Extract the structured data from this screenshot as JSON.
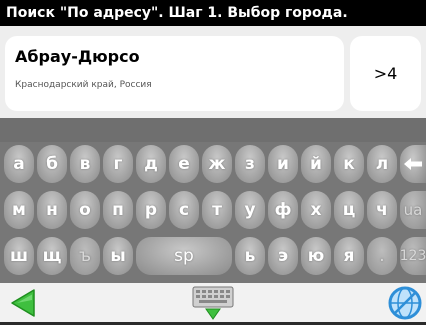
{
  "header": {
    "title": "Поиск \"По адресу\". Шаг 1. Выбор города."
  },
  "result": {
    "name": "Абрау-Дюрсо",
    "region": "Краснодарский край, Россия",
    "count": ">4"
  },
  "keyboard": {
    "row1": [
      "а",
      "б",
      "в",
      "г",
      "д",
      "е",
      "ж",
      "з",
      "и",
      "й",
      "к",
      "л"
    ],
    "row2": [
      "м",
      "н",
      "о",
      "п",
      "р",
      "с",
      "т",
      "у",
      "ф",
      "х",
      "ц",
      "ч",
      "ua"
    ],
    "row3_left": [
      "ш",
      "щ",
      "ъ",
      "ы"
    ],
    "space": "sp",
    "row3_right": [
      "ь",
      "э",
      "ю",
      "я",
      ".",
      "123"
    ],
    "backspace_icon": "backspace-arrow-icon"
  },
  "toolbar": {
    "back_icon": "back-arrow-icon",
    "keyboard_icon": "keyboard-icon",
    "globe_icon": "globe-icon"
  },
  "colors": {
    "title_bg": "#000000",
    "panel_bg": "#eeeeee",
    "keyboard_bg": "#777777",
    "back_arrow": "#3fbf3f",
    "globe": "#2e8fd8"
  }
}
